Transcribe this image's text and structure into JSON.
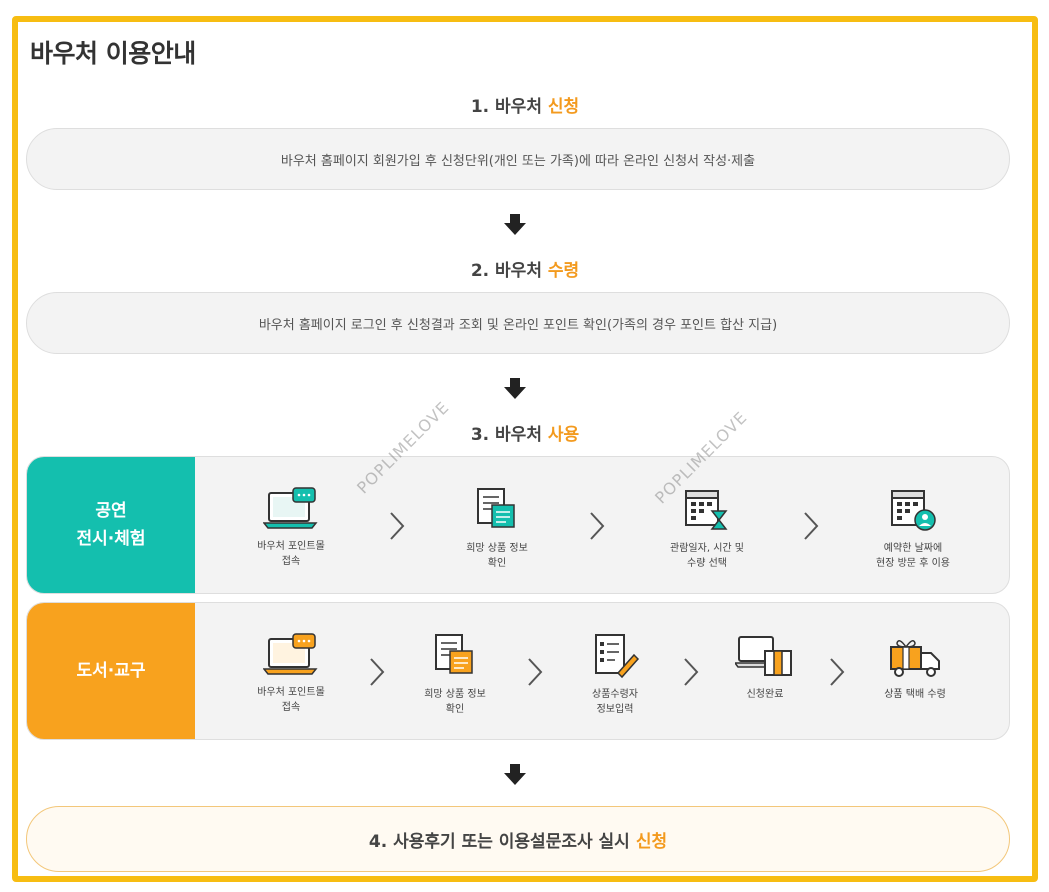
{
  "page": {
    "title": "바우처 이용안내"
  },
  "steps": {
    "s1": {
      "prefix": "1. 바우처",
      "highlight": "신청",
      "desc": "바우처 홈페이지 회원가입 후 신청단위(개인 또는 가족)에 따라 온라인 신청서 작성·제출"
    },
    "s2": {
      "prefix": "2. 바우처",
      "highlight": "수령",
      "desc": "바우처 홈페이지 로그인 후 신청결과 조회 및 온라인 포인트 확인(가족의 경우 포인트 합산 지급)"
    },
    "s3": {
      "prefix": "3. 바우처",
      "highlight": "사용"
    },
    "s4": {
      "prefix": "4. 사용후기 또는 이용설문조사 실시",
      "highlight": "신청"
    }
  },
  "use_rows": {
    "performance": {
      "cat_line1": "공연",
      "cat_line2": "전시·체험",
      "items": [
        {
          "line1": "바우처 포인트몰",
          "line2": "접속",
          "icon": "laptop-chat-icon"
        },
        {
          "line1": "희망 상품 정보",
          "line2": "확인",
          "icon": "document-icon"
        },
        {
          "line1": "관람일자, 시간 및",
          "line2": "수량 선택",
          "icon": "calendar-hourglass-icon"
        },
        {
          "line1": "예약한 날짜에",
          "line2": "현장 방문 후 이용",
          "icon": "calendar-person-icon"
        }
      ]
    },
    "books": {
      "cat_label": "도서·교구",
      "items": [
        {
          "line1": "바우처 포인트몰",
          "line2": "접속",
          "icon": "laptop-chat-icon"
        },
        {
          "line1": "희망 상품 정보",
          "line2": "확인",
          "icon": "document-icon"
        },
        {
          "line1": "상품수령자",
          "line2": "정보입력",
          "icon": "form-pencil-icon"
        },
        {
          "line1": "신청완료",
          "line2": "",
          "icon": "laptop-box-icon"
        },
        {
          "line1": "상품 택배 수령",
          "line2": "",
          "icon": "gift-truck-icon"
        }
      ]
    }
  },
  "watermark": "POPLIMELOVE",
  "colors": {
    "frame": "#f7bd12",
    "accent": "#f39a1e",
    "teal": "#14bfae",
    "orange": "#f8a21e"
  }
}
